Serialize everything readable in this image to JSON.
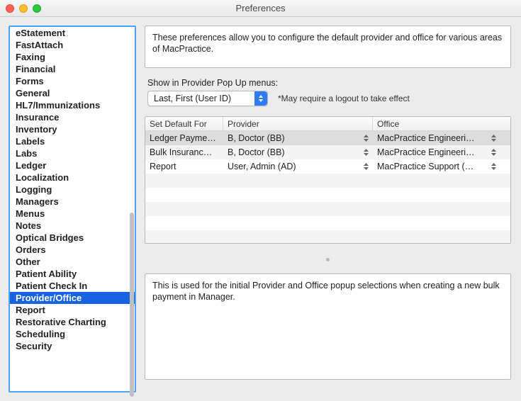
{
  "window": {
    "title": "Preferences"
  },
  "sidebar": {
    "selected_index": 19,
    "items": [
      {
        "label": "eStatement"
      },
      {
        "label": "FastAttach"
      },
      {
        "label": "Faxing"
      },
      {
        "label": "Financial"
      },
      {
        "label": "Forms"
      },
      {
        "label": "General"
      },
      {
        "label": "HL7/Immunizations"
      },
      {
        "label": "Insurance"
      },
      {
        "label": "Inventory"
      },
      {
        "label": "Labels"
      },
      {
        "label": "Labs"
      },
      {
        "label": "Ledger"
      },
      {
        "label": "Localization"
      },
      {
        "label": "Logging"
      },
      {
        "label": "Managers"
      },
      {
        "label": "Menus"
      },
      {
        "label": "Notes"
      },
      {
        "label": "Optical Bridges"
      },
      {
        "label": "Orders"
      },
      {
        "label": "Other"
      },
      {
        "label": "Patient Ability"
      },
      {
        "label": "Patient Check In"
      },
      {
        "label": "Provider/Office"
      },
      {
        "label": "Report"
      },
      {
        "label": "Restorative Charting"
      },
      {
        "label": "Scheduling"
      },
      {
        "label": "Security"
      }
    ]
  },
  "main": {
    "description": "These preferences allow you to configure the default provider and office for various areas of MacPractice.",
    "popup_label": "Show in Provider Pop Up menus:",
    "popup_value": "Last, First (User ID)",
    "popup_note": "*May require a logout to take effect",
    "help": "This is used for the initial Provider and Office popup selections when creating a new bulk payment in Manager."
  },
  "table": {
    "columns": {
      "set": "Set Default For",
      "provider": "Provider",
      "office": "Office"
    },
    "rows": [
      {
        "set": "Ledger Payme…",
        "provider": "B, Doctor (BB)",
        "office": "MacPractice Engineeri…",
        "selected": true
      },
      {
        "set": "Bulk Insuranc…",
        "provider": "B, Doctor (BB)",
        "office": "MacPractice Engineeri…",
        "selected": false
      },
      {
        "set": "Report",
        "provider": "User, Admin (AD)",
        "office": "MacPractice Support (…",
        "selected": false
      }
    ]
  }
}
